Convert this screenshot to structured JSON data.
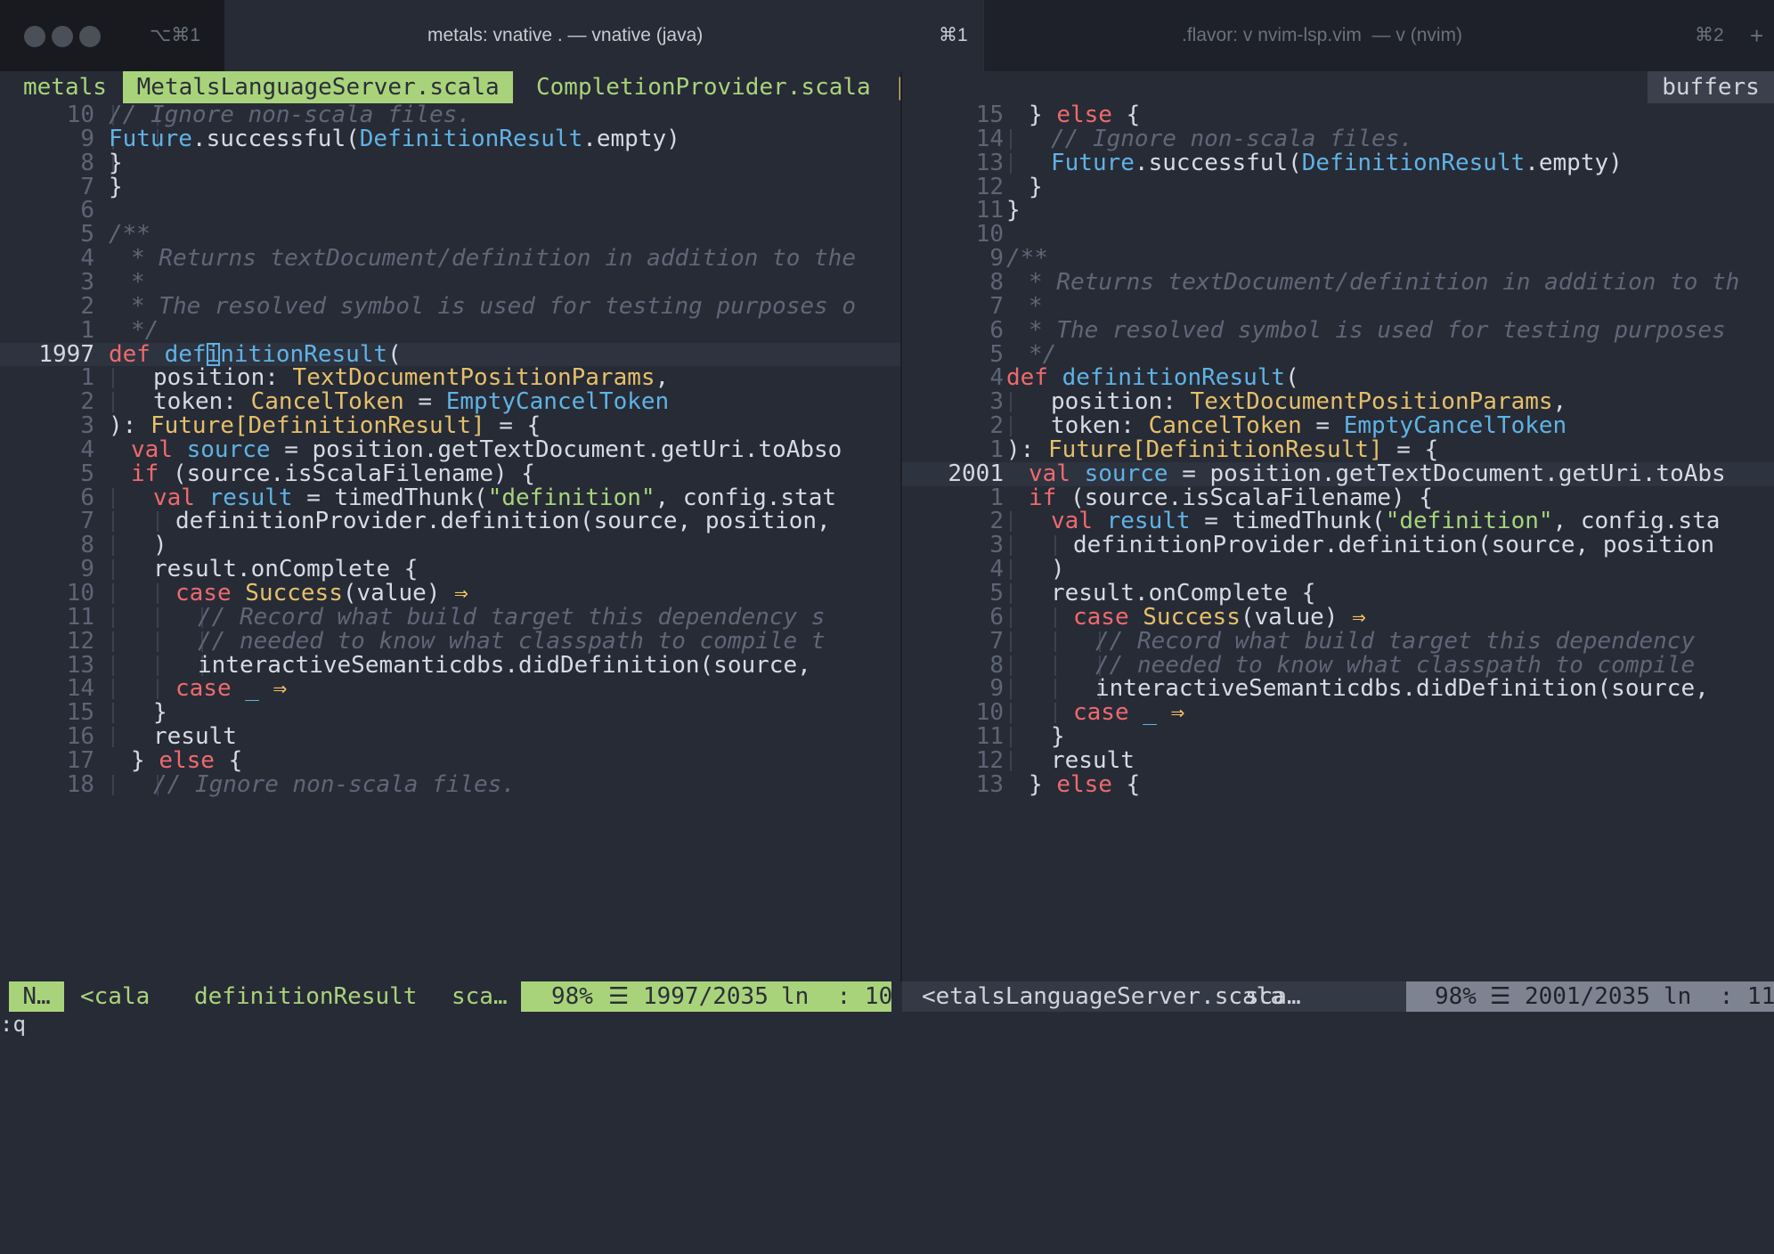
{
  "window": {
    "hotkey_left": "⌥⌘1",
    "title_left": "metals: vnative . — vnative (java)",
    "hotkey_mid": "⌘1",
    "title_right": ".flavor: v nvim-lsp.vim  — v (nvim)",
    "hotkey_right": "⌘2",
    "plus": "+"
  },
  "bufferline": {
    "project": "metals",
    "active_buffer": " MetalsLanguageServer.scala ",
    "other_buffer": "CompletionProvider.scala",
    "separator": "|",
    "buffers_label": "buffers"
  },
  "colors": {
    "background": "#272b36",
    "accent_green": "#a9d37b",
    "keyword_red": "#ee6a6d",
    "type_blue": "#5fb3e4",
    "type_yellow": "#e5c06a",
    "comment_gray": "#5f6777"
  },
  "left_pane": {
    "lines": [
      {
        "n": "10",
        "i": [
          1,
          2
        ],
        "t": [
          [
            "c-com",
            "// Ignore non-scala files."
          ]
        ]
      },
      {
        "n": "9",
        "i": [
          1,
          2
        ],
        "t": [
          [
            "c-type",
            "Future"
          ],
          [
            "",
            "."
          ],
          [
            "",
            "successful("
          ],
          [
            "c-type",
            "DefinitionResult"
          ],
          [
            "",
            ".empty)"
          ]
        ]
      },
      {
        "n": "8",
        "i": [
          1
        ],
        "t": [
          [
            "",
            "}"
          ]
        ]
      },
      {
        "n": "7",
        "i": [],
        "t": [
          [
            "",
            "}"
          ]
        ]
      },
      {
        "n": "6",
        "i": [],
        "t": []
      },
      {
        "n": "5",
        "i": [],
        "t": [
          [
            "c-com",
            "/**"
          ]
        ]
      },
      {
        "n": "4",
        "i": [],
        "t": [
          [
            "c-com",
            "* Returns textDocument/definition in addition to the"
          ]
        ],
        "o": 1
      },
      {
        "n": "3",
        "i": [],
        "t": [
          [
            "c-com",
            "*"
          ]
        ],
        "o": 1
      },
      {
        "n": "2",
        "i": [],
        "t": [
          [
            "c-com",
            "* The resolved symbol is used for testing purposes o"
          ]
        ],
        "o": 1
      },
      {
        "n": "1",
        "i": [],
        "t": [
          [
            "c-com",
            "*/"
          ]
        ],
        "o": 1
      },
      {
        "n": "1997",
        "i": [],
        "t": [
          [
            "c-kw",
            "def"
          ],
          [
            "",
            " "
          ],
          [
            "c-type",
            "def"
          ],
          [
            "cur",
            "i"
          ],
          [
            "c-type",
            "nitionResult"
          ],
          [
            "",
            "("
          ]
        ],
        "cur": 1
      },
      {
        "n": "1",
        "i": [
          1
        ],
        "t": [
          [
            "",
            "position: "
          ],
          [
            "c-ytype",
            "TextDocumentPositionParams"
          ],
          [
            "",
            ","
          ]
        ],
        "o": 2
      },
      {
        "n": "2",
        "i": [
          1
        ],
        "t": [
          [
            "",
            "token: "
          ],
          [
            "c-ytype",
            "CancelToken"
          ],
          [
            "",
            " = "
          ],
          [
            "c-type",
            "EmptyCancelToken"
          ]
        ],
        "o": 2
      },
      {
        "n": "3",
        "i": [],
        "t": [
          [
            "",
            "): "
          ],
          [
            "c-ytype",
            "Future[DefinitionResult]"
          ],
          [
            "",
            " = {"
          ]
        ]
      },
      {
        "n": "4",
        "i": [],
        "t": [
          [
            "c-kw",
            "val"
          ],
          [
            "",
            " "
          ],
          [
            "c-type",
            "source"
          ],
          [
            "",
            " = position.getTextDocument.getUri.toAbso"
          ]
        ],
        "o": 1
      },
      {
        "n": "5",
        "i": [],
        "t": [
          [
            "c-kw",
            "if"
          ],
          [
            "",
            " (source.isScalaFilename) {"
          ]
        ],
        "o": 1
      },
      {
        "n": "6",
        "i": [
          1
        ],
        "t": [
          [
            "c-kw",
            "val"
          ],
          [
            "",
            " "
          ],
          [
            "c-type",
            "result"
          ],
          [
            "",
            " = timedThunk("
          ],
          [
            "c-str",
            "\"definition\""
          ],
          [
            "",
            ", config.stat"
          ]
        ],
        "o": 2
      },
      {
        "n": "7",
        "i": [
          1,
          2
        ],
        "t": [
          [
            "",
            "definitionProvider.definition(source, position,"
          ]
        ],
        "o": 3
      },
      {
        "n": "8",
        "i": [
          1
        ],
        "t": [
          [
            "",
            ")"
          ]
        ],
        "o": 2
      },
      {
        "n": "9",
        "i": [
          1
        ],
        "t": [
          [
            "",
            "result.onComplete {"
          ]
        ],
        "o": 2
      },
      {
        "n": "10",
        "i": [
          1,
          2
        ],
        "t": [
          [
            "c-kw",
            "case"
          ],
          [
            "",
            " "
          ],
          [
            "c-ytype",
            "Success"
          ],
          [
            "",
            "(value) "
          ],
          [
            "c-op",
            "⇒"
          ]
        ],
        "o": 3
      },
      {
        "n": "11",
        "i": [
          1,
          2,
          3
        ],
        "t": [
          [
            "c-com",
            "// Record what build target this dependency s"
          ]
        ],
        "o": 4
      },
      {
        "n": "12",
        "i": [
          1,
          2,
          3
        ],
        "t": [
          [
            "c-com",
            "// needed to know what classpath to compile t"
          ]
        ],
        "o": 4
      },
      {
        "n": "13",
        "i": [
          1,
          2,
          3
        ],
        "t": [
          [
            "",
            "interactiveSemanticdbs.didDefinition(source,"
          ]
        ],
        "o": 4
      },
      {
        "n": "14",
        "i": [
          1,
          2
        ],
        "t": [
          [
            "c-kw",
            "case"
          ],
          [
            "",
            " "
          ],
          [
            "c-type",
            "_"
          ],
          [
            "",
            " "
          ],
          [
            "c-op",
            "⇒"
          ]
        ],
        "o": 3
      },
      {
        "n": "15",
        "i": [
          1
        ],
        "t": [
          [
            "",
            "}"
          ]
        ],
        "o": 2
      },
      {
        "n": "16",
        "i": [
          1
        ],
        "t": [
          [
            "",
            "result"
          ]
        ],
        "o": 2
      },
      {
        "n": "17",
        "i": [],
        "t": [
          [
            "",
            "} "
          ],
          [
            "c-kw",
            "else"
          ],
          [
            "",
            " {"
          ]
        ],
        "o": 1
      },
      {
        "n": "18",
        "i": [
          1,
          2
        ],
        "t": [
          [
            "c-com",
            "// Ignore non-scala files."
          ]
        ],
        "o": 2
      }
    ]
  },
  "right_pane": {
    "lines": [
      {
        "n": "15",
        "i": [],
        "t": [
          [
            "",
            "} "
          ],
          [
            "c-kw",
            "else"
          ],
          [
            "",
            " {"
          ]
        ],
        "o": 1
      },
      {
        "n": "14",
        "i": [
          1
        ],
        "t": [
          [
            "c-com",
            "// Ignore non-scala files."
          ]
        ],
        "o": 2
      },
      {
        "n": "13",
        "i": [
          1
        ],
        "t": [
          [
            "c-type",
            "Future"
          ],
          [
            "",
            ".successful("
          ],
          [
            "c-type",
            "DefinitionResult"
          ],
          [
            "",
            ".empty)"
          ]
        ],
        "o": 2
      },
      {
        "n": "12",
        "i": [],
        "t": [
          [
            "",
            "}"
          ]
        ],
        "o": 1
      },
      {
        "n": "11",
        "i": [],
        "t": [
          [
            "",
            "}"
          ]
        ]
      },
      {
        "n": "10",
        "i": [],
        "t": []
      },
      {
        "n": "9",
        "i": [],
        "t": [
          [
            "c-com",
            "/**"
          ]
        ]
      },
      {
        "n": "8",
        "i": [],
        "t": [
          [
            "c-com",
            "* Returns textDocument/definition in addition to th"
          ]
        ],
        "o": 1
      },
      {
        "n": "7",
        "i": [],
        "t": [
          [
            "c-com",
            "*"
          ]
        ],
        "o": 1
      },
      {
        "n": "6",
        "i": [],
        "t": [
          [
            "c-com",
            "* The resolved symbol is used for testing purposes"
          ]
        ],
        "o": 1
      },
      {
        "n": "5",
        "i": [],
        "t": [
          [
            "c-com",
            "*/"
          ]
        ],
        "o": 1
      },
      {
        "n": "4",
        "i": [],
        "t": [
          [
            "c-kw",
            "def"
          ],
          [
            "",
            " "
          ],
          [
            "c-type",
            "definitionResult"
          ],
          [
            "",
            "("
          ]
        ]
      },
      {
        "n": "3",
        "i": [
          1
        ],
        "t": [
          [
            "",
            "position: "
          ],
          [
            "c-ytype",
            "TextDocumentPositionParams"
          ],
          [
            "",
            ","
          ]
        ],
        "o": 2
      },
      {
        "n": "2",
        "i": [
          1
        ],
        "t": [
          [
            "",
            "token: "
          ],
          [
            "c-ytype",
            "CancelToken"
          ],
          [
            "",
            " = "
          ],
          [
            "c-type",
            "EmptyCancelToken"
          ]
        ],
        "o": 2
      },
      {
        "n": "1",
        "i": [],
        "t": [
          [
            "",
            "): "
          ],
          [
            "c-ytype",
            "Future[DefinitionResult]"
          ],
          [
            "",
            " = {"
          ]
        ]
      },
      {
        "n": "2001",
        "i": [],
        "t": [
          [
            "c-kw",
            "val"
          ],
          [
            "",
            " "
          ],
          [
            "c-type",
            "source"
          ],
          [
            "",
            " = position.getTextDocument.getUri.toAbs"
          ]
        ],
        "o": 1,
        "cur": 1
      },
      {
        "n": "1",
        "i": [],
        "t": [
          [
            "c-kw",
            "if"
          ],
          [
            "",
            " (source.isScalaFilename) {"
          ]
        ],
        "o": 1
      },
      {
        "n": "2",
        "i": [
          1
        ],
        "t": [
          [
            "c-kw",
            "val"
          ],
          [
            "",
            " "
          ],
          [
            "c-type",
            "result"
          ],
          [
            "",
            " = timedThunk("
          ],
          [
            "c-str",
            "\"definition\""
          ],
          [
            "",
            ", config.sta"
          ]
        ],
        "o": 2
      },
      {
        "n": "3",
        "i": [
          1,
          2
        ],
        "t": [
          [
            "",
            "definitionProvider.definition(source, position"
          ]
        ],
        "o": 3
      },
      {
        "n": "4",
        "i": [
          1
        ],
        "t": [
          [
            "",
            ")"
          ]
        ],
        "o": 2
      },
      {
        "n": "5",
        "i": [
          1
        ],
        "t": [
          [
            "",
            "result.onComplete {"
          ]
        ],
        "o": 2
      },
      {
        "n": "6",
        "i": [
          1,
          2
        ],
        "t": [
          [
            "c-kw",
            "case"
          ],
          [
            "",
            " "
          ],
          [
            "c-ytype",
            "Success"
          ],
          [
            "",
            "(value) "
          ],
          [
            "c-op",
            "⇒"
          ]
        ],
        "o": 3
      },
      {
        "n": "7",
        "i": [
          1,
          2,
          3
        ],
        "t": [
          [
            "c-com",
            "// Record what build target this dependency"
          ]
        ],
        "o": 4
      },
      {
        "n": "8",
        "i": [
          1,
          2,
          3
        ],
        "t": [
          [
            "c-com",
            "// needed to know what classpath to compile"
          ]
        ],
        "o": 4
      },
      {
        "n": "9",
        "i": [
          1,
          2,
          3
        ],
        "t": [
          [
            "",
            "interactiveSemanticdbs.didDefinition(source,"
          ]
        ],
        "o": 4
      },
      {
        "n": "10",
        "i": [
          1,
          2
        ],
        "t": [
          [
            "c-kw",
            "case"
          ],
          [
            "",
            " "
          ],
          [
            "c-type",
            "_"
          ],
          [
            "",
            " "
          ],
          [
            "c-op",
            "⇒"
          ]
        ],
        "o": 3
      },
      {
        "n": "11",
        "i": [
          1
        ],
        "t": [
          [
            "",
            "}"
          ]
        ],
        "o": 2
      },
      {
        "n": "12",
        "i": [
          1
        ],
        "t": [
          [
            "",
            "result"
          ]
        ],
        "o": 2
      },
      {
        "n": "13",
        "i": [],
        "t": [
          [
            "",
            "} "
          ],
          [
            "c-kw",
            "else"
          ],
          [
            "",
            " {"
          ]
        ],
        "o": 1
      }
    ]
  },
  "status_left": {
    "mode": "N…",
    "file": "<cala",
    "func": "definitionResult",
    "ft": "sca…",
    "percent": "98%",
    "position": "☰ 1997/2035",
    "col": "ln  : 10"
  },
  "status_right": {
    "file": "<etalsLanguageServer.scala",
    "ft": "sca…",
    "percent": "98%",
    "position": "☰ 2001/2035",
    "col": "ln  : 11"
  },
  "cmdline": ":q"
}
